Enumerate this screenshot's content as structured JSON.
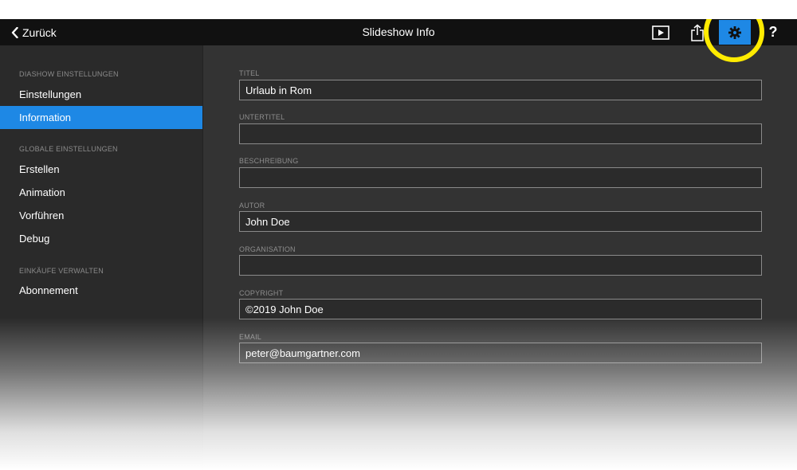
{
  "topbar": {
    "back_label": "Zurück",
    "title": "Slideshow Info",
    "help_label": "?"
  },
  "sidebar": {
    "sections": [
      {
        "header": "DIASHOW EINSTELLUNGEN",
        "items": [
          "Einstellungen",
          "Information"
        ]
      },
      {
        "header": "GLOBALE EINSTELLUNGEN",
        "items": [
          "Erstellen",
          "Animation",
          "Vorführen",
          "Debug"
        ]
      },
      {
        "header": "EINKÄUFE VERWALTEN",
        "items": [
          "Abonnement"
        ]
      }
    ],
    "active_item": "Information"
  },
  "form": {
    "fields": [
      {
        "label": "TITEL",
        "value": "Urlaub in Rom"
      },
      {
        "label": "UNTERTITEL",
        "value": ""
      },
      {
        "label": "BESCHREIBUNG",
        "value": ""
      },
      {
        "label": "AUTOR",
        "value": "John Doe"
      },
      {
        "label": "ORGANISATION",
        "value": ""
      },
      {
        "label": "COPYRIGHT",
        "value": "©2019 John Doe"
      },
      {
        "label": "EMAIL",
        "value": "peter@baumgartner.com"
      }
    ]
  },
  "colors": {
    "accent": "#1e88e5",
    "highlight_ring": "#ffeb00",
    "topbar_bg": "#111111",
    "sidebar_bg": "#2a2a2a",
    "content_bg": "#333333"
  },
  "icons": {
    "back": "chevron-left-icon",
    "play": "play-icon",
    "share": "share-icon",
    "settings": "gear-icon",
    "help": "question-mark-icon"
  }
}
